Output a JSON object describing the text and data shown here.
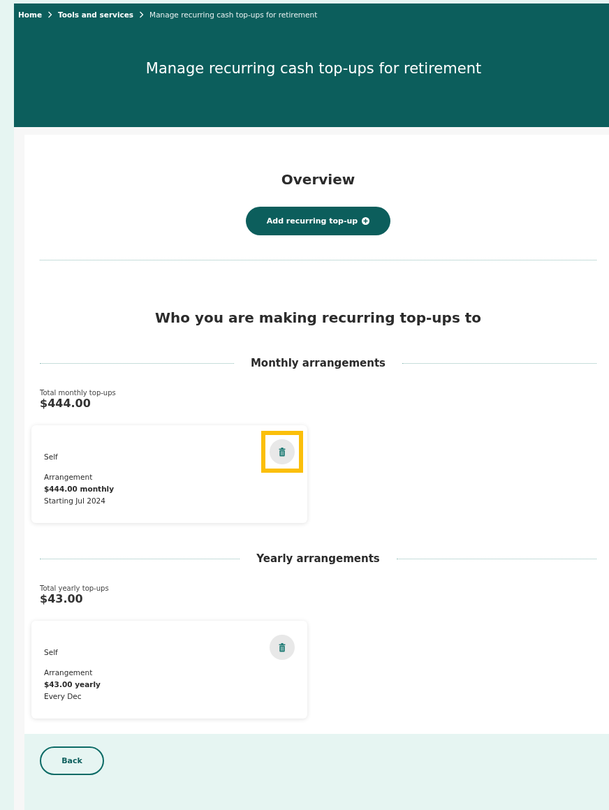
{
  "breadcrumbs": [
    {
      "label": "Home",
      "current": false
    },
    {
      "label": "Tools and services",
      "current": false
    },
    {
      "label": "Manage recurring cash top-ups for retirement",
      "current": true
    }
  ],
  "title": "Manage recurring cash top-ups for retirement",
  "overview": {
    "heading": "Overview",
    "add_button": "Add recurring top-up"
  },
  "recipients_heading": "Who you are making recurring top-ups to",
  "sections": [
    {
      "heading": "Monthly arrangements",
      "total_label": "Total monthly top-ups",
      "total": "$444.00",
      "cards": [
        {
          "recipient": "Self",
          "label": "Arrangement",
          "amount": "$444.00 monthly",
          "schedule": "Starting Jul 2024",
          "highlighted": true
        }
      ]
    },
    {
      "heading": "Yearly arrangements",
      "total_label": "Total yearly top-ups",
      "total": "$43.00",
      "cards": [
        {
          "recipient": "Self",
          "label": "Arrangement",
          "amount": "$43.00 yearly",
          "schedule": "Every Dec",
          "highlighted": false
        }
      ]
    }
  ],
  "back_button": "Back"
}
